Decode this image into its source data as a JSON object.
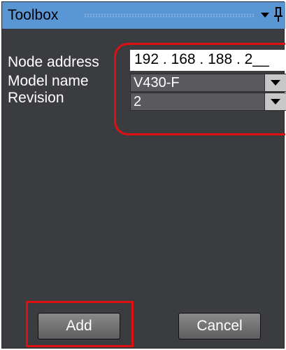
{
  "window": {
    "title": "Toolbox"
  },
  "form": {
    "node_address_label": "Node address",
    "node_address_value": "192 . 168 . 188 . 2__",
    "model_label": "Model name",
    "model_value": "V430-F",
    "revision_label": "Revision",
    "revision_value": "2"
  },
  "buttons": {
    "add": "Add",
    "cancel": "Cancel"
  },
  "icons": {
    "dropdown": "chevron-down-icon",
    "pin": "pin-icon",
    "select_arrow": "dropdown-arrow-icon"
  },
  "colors": {
    "panel_bg": "#3b3c3f",
    "title_bar": "#5a95d4",
    "highlight": "#e01010",
    "button": "#7a7a7a"
  }
}
